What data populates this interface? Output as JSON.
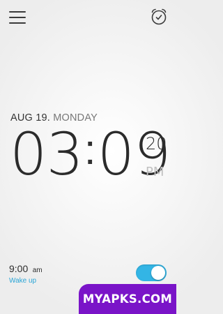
{
  "header": {
    "menu_icon": "hamburger-menu-icon",
    "alarm_icon": "alarm-clock-icon"
  },
  "clock": {
    "date": "AUG 19.",
    "day": "MONDAY",
    "hours": "03",
    "separator": ":",
    "minutes": "09",
    "seconds": "20",
    "ampm": "PM"
  },
  "alarm": {
    "time": "9:00",
    "ampm": "am",
    "label": "Wake up",
    "enabled": true,
    "toggle_color": "#33b5e5"
  },
  "watermark": {
    "text": "MYAPKS.COM",
    "color": "#7a14c8"
  }
}
